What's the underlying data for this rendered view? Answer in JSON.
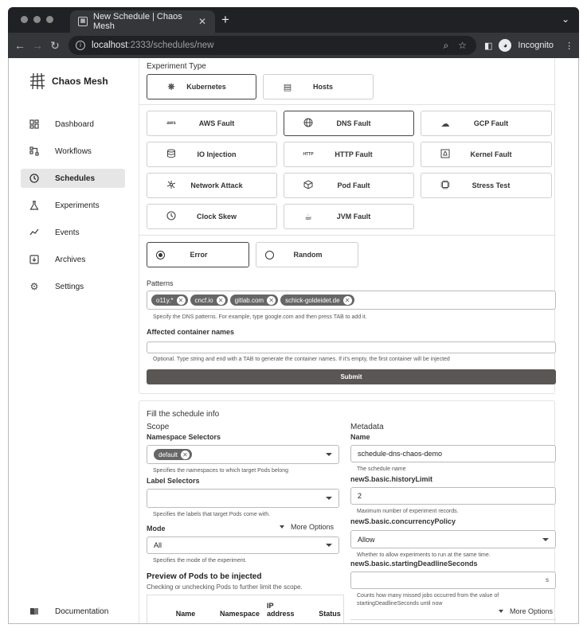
{
  "browser": {
    "tab_title": "New Schedule | Chaos Mesh",
    "url_host": "localhost",
    "url_path": ":2333/schedules/new",
    "profile_label": "Incognito"
  },
  "sidebar": {
    "brand": "Chaos Mesh",
    "items": [
      {
        "label": "Dashboard",
        "icon": "dashboard-icon"
      },
      {
        "label": "Workflows",
        "icon": "workflow-icon"
      },
      {
        "label": "Schedules",
        "icon": "clock-icon",
        "active": true
      },
      {
        "label": "Experiments",
        "icon": "flask-icon"
      },
      {
        "label": "Events",
        "icon": "chart-line-icon"
      },
      {
        "label": "Archives",
        "icon": "archive-icon"
      },
      {
        "label": "Settings",
        "icon": "gear-icon"
      }
    ],
    "documentation": "Documentation"
  },
  "experiment": {
    "type_title": "Experiment Type",
    "env_options": [
      {
        "label": "Kubernetes",
        "selected": true
      },
      {
        "label": "Hosts",
        "selected": false
      }
    ],
    "faults": [
      {
        "label": "AWS Fault",
        "icon_text": "aws"
      },
      {
        "label": "DNS Fault",
        "selected": true
      },
      {
        "label": "GCP Fault"
      },
      {
        "label": "IO Injection"
      },
      {
        "label": "HTTP Fault",
        "icon_text": "HTTP"
      },
      {
        "label": "Kernel Fault"
      },
      {
        "label": "Network Attack"
      },
      {
        "label": "Pod Fault"
      },
      {
        "label": "Stress Test"
      },
      {
        "label": "Clock Skew"
      },
      {
        "label": "JVM Fault"
      }
    ],
    "actions": [
      {
        "label": "Error",
        "selected": true
      },
      {
        "label": "Random",
        "selected": false
      }
    ],
    "patterns_label": "Patterns",
    "patterns": [
      "o11y.*",
      "cncf.io",
      "gitlab.com",
      "schick-goldeidet.de"
    ],
    "patterns_helper": "Specify the DNS patterns. For example, type google.com and then press TAB to add it.",
    "containers_label": "Affected container names",
    "containers_helper": "Optional. Type string and end with a TAB to generate the container names. If it's empty, the first container will be injected",
    "submit": "Submit"
  },
  "schedule": {
    "title": "Fill the schedule info",
    "scope": {
      "title": "Scope",
      "ns_label": "Namespace Selectors",
      "ns_chip": "default",
      "ns_helper": "Specifies the namespaces to which target Pods belong",
      "label_label": "Label Selectors",
      "label_helper": "Specifies the labels that target Pods come with.",
      "mode_label": "Mode",
      "more_options": "More Options",
      "mode_value": "All",
      "mode_helper": "Specifies the mode of the experiment.",
      "preview_title": "Preview of Pods to be injected",
      "preview_subtitle": "Checking or unchecking Pods to further limit the scope.",
      "columns": [
        "Name",
        "Namespace",
        "IP address",
        "Status"
      ]
    },
    "metadata": {
      "title": "Metadata",
      "name_label": "Name",
      "name_value": "schedule-dns-chaos-demo",
      "name_helper": "The schedule name",
      "history_label": "newS.basic.historyLimit",
      "history_value": "2",
      "history_helper": "Maximum number of experiment records.",
      "concurrency_label": "newS.basic.concurrencyPolicy",
      "concurrency_value": "Allow",
      "concurrency_helper": "Whether to allow experiments to run at the same time.",
      "deadline_label": "newS.basic.startingDeadlineSeconds",
      "deadline_suffix": "s",
      "deadline_helper_1": "Counts how many missed jobs occurred from the value of",
      "deadline_helper_2": "startingDeadlineSeconds until now",
      "more_options": "More Options"
    }
  }
}
